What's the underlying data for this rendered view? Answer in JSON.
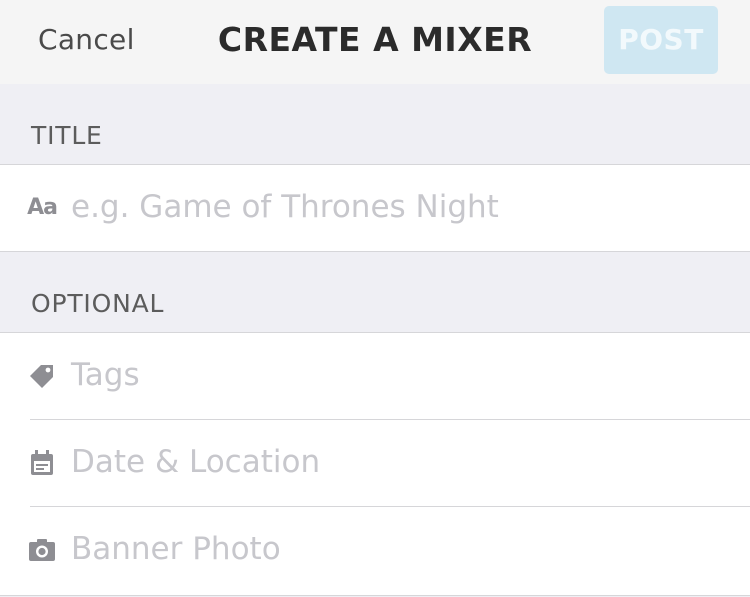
{
  "navbar": {
    "cancel_label": "Cancel",
    "title": "CREATE A MIXER",
    "post_label": "POST"
  },
  "sections": {
    "title_header": "TITLE",
    "optional_header": "OPTIONAL"
  },
  "title_field": {
    "icon_label": "Aa",
    "placeholder": "e.g. Game of Thrones Night"
  },
  "optional_rows": [
    {
      "icon": "tag-icon",
      "label": "Tags"
    },
    {
      "icon": "calendar-icon",
      "label": "Date & Location"
    },
    {
      "icon": "camera-icon",
      "label": "Banner Photo"
    }
  ],
  "colors": {
    "post_button_bg": "#cfe7f2",
    "placeholder_text": "#c7c7cc",
    "icon_gray": "#8e8e93"
  }
}
